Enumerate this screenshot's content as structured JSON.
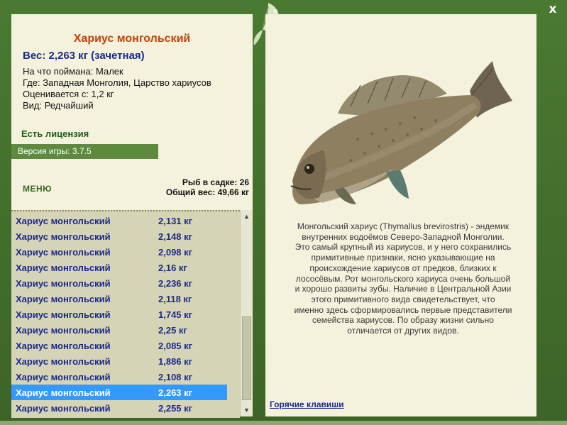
{
  "window": {
    "close_label": "x"
  },
  "fish": {
    "title": "Хариус монгольский",
    "weight": "Вес: 2,263 кг (зачетная)",
    "details": [
      "На что поймана: Малек",
      "Где: Западная Монголия, Царство хариусов",
      "Оценивается с: 1,2 кг",
      "Вид: Редчайший"
    ]
  },
  "license": "Есть лицензия",
  "version": "Версия игры: 3.7.5",
  "menu_label": "МЕНЮ",
  "stats": {
    "in_cage": "Рыб в садке: 26",
    "total_weight": "Общий вес: 49,66 кг"
  },
  "catch_list": [
    {
      "name": "Хариус монгольский",
      "weight": "2,131 кг"
    },
    {
      "name": "Хариус монгольский",
      "weight": "2,148 кг"
    },
    {
      "name": "Хариус монгольский",
      "weight": "2,098 кг"
    },
    {
      "name": "Хариус монгольский",
      "weight": "2,16 кг"
    },
    {
      "name": "Хариус монгольский",
      "weight": "2,236 кг"
    },
    {
      "name": "Хариус монгольский",
      "weight": "2,118 кг"
    },
    {
      "name": "Хариус монгольский",
      "weight": "1,745 кг"
    },
    {
      "name": "Хариус монгольский",
      "weight": "2,25 кг"
    },
    {
      "name": "Хариус монгольский",
      "weight": "2,085 кг"
    },
    {
      "name": "Хариус монгольский",
      "weight": "1,886 кг"
    },
    {
      "name": "Хариус монгольский",
      "weight": "2,108 кг"
    },
    {
      "name": "Хариус монгольский",
      "weight": "2,263 кг"
    },
    {
      "name": "Хариус монгольский",
      "weight": "2,255 кг"
    }
  ],
  "selected_index": 11,
  "description_lines": [
    "Монгольский хариус (Thymallus brevirostris) - эндемик",
    "внутренних водоёмов Северо-Западной Монголии.",
    "Это самый крупный из хариусов, и у него сохранились",
    "примитивные признаки, ясно указывающие на",
    "происхождение хариусов от предков, близких к",
    "лососёвым. Рот монгольского хариуса очень большой",
    "и хорошо развиты зубы. Наличие в Центральной Азии",
    "этого примитивного вида свидетельствует, что",
    "именно здесь сформировались первые представители",
    "семейства хариусов. По образу жизни сильно",
    "отличается от других видов."
  ],
  "hotkeys_label": "Горячие клавиши",
  "icons": {
    "close": "close-icon",
    "logo": "leaf-logo-icon",
    "scroll_up": "arrow-up-icon",
    "scroll_down": "arrow-down-icon",
    "fish": "grayling-fish-image"
  },
  "colors": {
    "frame": "#4a7a32",
    "panel": "#f4f2dc",
    "title": "#c2410c",
    "weight": "#1d2a8a",
    "license": "#1f5e1a",
    "selected_row": "#3399ff"
  }
}
